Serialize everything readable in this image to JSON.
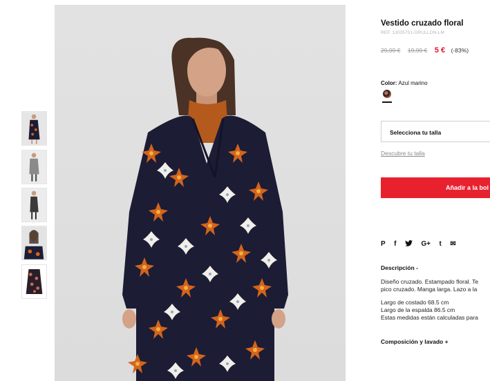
{
  "product": {
    "title": "Vestido cruzado floral",
    "ref": "REF. 13035751-GRULLON-LM",
    "price_old_1": "29,99 €",
    "price_old_2": "19,99 €",
    "price_sale": "5 €",
    "discount": "(-83%)"
  },
  "color": {
    "label": "Color:",
    "value": "Azul marino"
  },
  "size": {
    "select_label": "Selecciona tu talla",
    "guide_link": "Descubre tu talla"
  },
  "cart": {
    "add_label": "Añadir a la bol"
  },
  "share": {
    "pinterest": "P",
    "facebook": "f",
    "twitter": "t",
    "googleplus": "G+",
    "tumblr": "t",
    "email": "✉"
  },
  "description": {
    "heading": "Descripción -",
    "lines": [
      "Diseño cruzado. Estampado floral. Te",
      "pico cruzado. Manga larga. Lazo a la",
      "Largo de costado 68.5 cm",
      "Largo de la espalda 86.5 cm",
      "Estas medidas están calculadas para"
    ]
  },
  "composition": {
    "heading": "Composición y lavado +"
  },
  "colors": {
    "accent": "#e8212f",
    "sale": "#e8112d",
    "dress": "#1c1c35",
    "flower_orange": "#d4641c"
  }
}
